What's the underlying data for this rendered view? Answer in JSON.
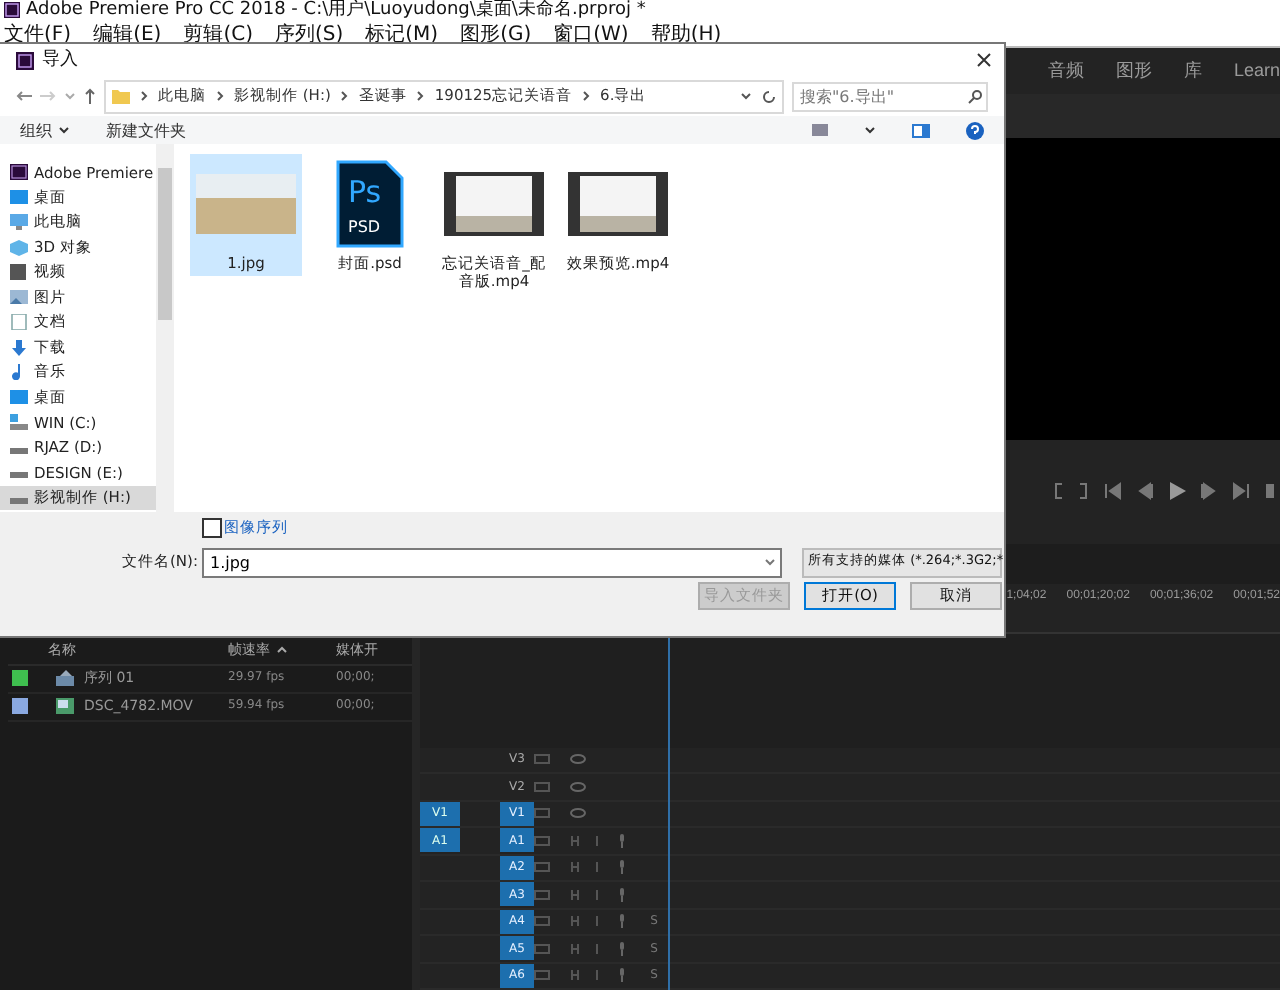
{
  "app": {
    "title": "Adobe Premiere Pro CC 2018 - C:\\用户\\Luoyudong\\桌面\\未命名.prproj *",
    "menu": [
      "文件(F)",
      "编辑(E)",
      "剪辑(C)",
      "序列(S)",
      "标记(M)",
      "图形(G)",
      "窗口(W)",
      "帮助(H)"
    ]
  },
  "workspace_tabs": [
    "音频",
    "图形",
    "库",
    "Learn"
  ],
  "timeline_ruler": [
    "1;04;02",
    "00;01;20;02",
    "00;01;36;02",
    "00;01;52"
  ],
  "dialog": {
    "title": "导入",
    "breadcrumb": [
      "此电脑",
      "影视制作 (H:)",
      "圣诞事",
      "190125忘记关语音",
      "6.导出"
    ],
    "search": {
      "placeholder": "搜索\"6.导出\""
    },
    "toolbar": [
      "组织",
      "新建文件夹"
    ],
    "nav": [
      {
        "label": "Adobe Premiere",
        "kind": "premiere",
        "selected": false
      },
      {
        "label": "桌面",
        "kind": "desktop",
        "selected": false
      },
      {
        "label": "此电脑",
        "kind": "pc",
        "selected": false
      },
      {
        "label": "3D 对象",
        "kind": "objects",
        "selected": false
      },
      {
        "label": "视频",
        "kind": "video",
        "selected": false
      },
      {
        "label": "图片",
        "kind": "pictures",
        "selected": false
      },
      {
        "label": "文档",
        "kind": "documents",
        "selected": false
      },
      {
        "label": "下载",
        "kind": "download",
        "selected": false
      },
      {
        "label": "音乐",
        "kind": "music",
        "selected": false
      },
      {
        "label": "桌面",
        "kind": "desktop",
        "selected": false
      },
      {
        "label": "WIN (C:)",
        "kind": "system-drive",
        "selected": false
      },
      {
        "label": "RJAZ (D:)",
        "kind": "drive",
        "selected": false
      },
      {
        "label": "DESIGN (E:)",
        "kind": "drive",
        "selected": false
      },
      {
        "label": "影视制作 (H:)",
        "kind": "drive",
        "selected": true
      }
    ],
    "files": [
      {
        "name": "1.jpg",
        "kind": "photo",
        "selected": true
      },
      {
        "name": "封面.psd",
        "kind": "psd",
        "badge": "Ps",
        "ext": "PSD",
        "selected": false
      },
      {
        "name": "忘记关语音_配音版.mp4",
        "kind": "video",
        "selected": false
      },
      {
        "name": "效果预览.mp4",
        "kind": "video",
        "selected": false
      }
    ],
    "image_sequence": {
      "label": "图像序列",
      "checked": false
    },
    "filename": {
      "label": "文件名(N):",
      "value": "1.jpg"
    },
    "filter": "所有支持的媒体 (*.264;*.3G2;*",
    "buttons": [
      {
        "label": "导入文件夹",
        "disabled": true,
        "primary": false
      },
      {
        "label": "打开(O)",
        "disabled": false,
        "primary": true
      },
      {
        "label": "取消",
        "disabled": false,
        "primary": false
      }
    ]
  },
  "project": {
    "columns": [
      "名称",
      "帧速率",
      "媒体开"
    ],
    "rows": [
      {
        "name": "序列 01",
        "kind": "sequence",
        "color": "#3fbf4f",
        "fps": "29.97 fps",
        "start": "00;00;"
      },
      {
        "name": "DSC_4782.MOV",
        "kind": "clip",
        "color": "#8aa8e0",
        "fps": "59.94 fps",
        "start": "00;00;"
      }
    ]
  },
  "tracks": [
    {
      "name": "V3",
      "kind": "video",
      "targeted": false
    },
    {
      "name": "V2",
      "kind": "video",
      "targeted": false
    },
    {
      "name": "V1",
      "kind": "video",
      "targeted": true,
      "source": "V1"
    },
    {
      "name": "A1",
      "kind": "audio",
      "targeted": true,
      "source": "A1"
    },
    {
      "name": "A2",
      "kind": "audio",
      "targeted": true
    },
    {
      "name": "A3",
      "kind": "audio",
      "targeted": true
    },
    {
      "name": "A4",
      "kind": "audio",
      "targeted": true,
      "solo": "S"
    },
    {
      "name": "A5",
      "kind": "audio",
      "targeted": true,
      "solo": "S"
    },
    {
      "name": "A6",
      "kind": "audio",
      "targeted": true,
      "solo": "S"
    }
  ]
}
